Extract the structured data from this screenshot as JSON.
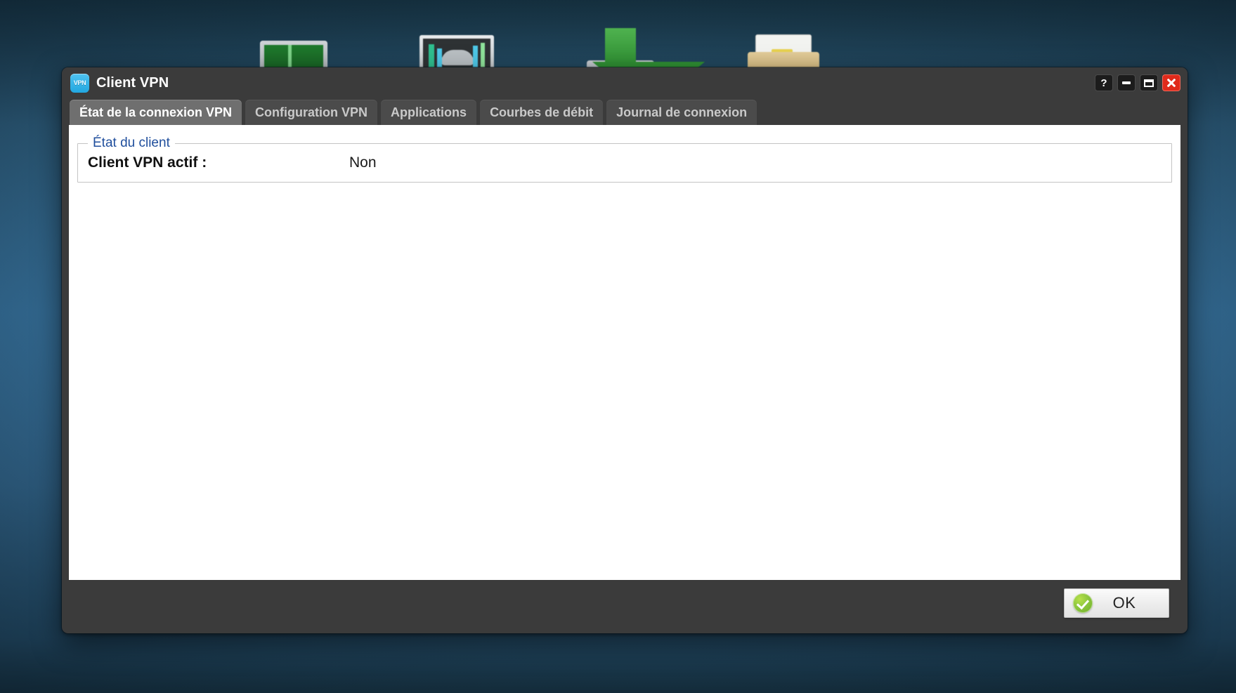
{
  "desktop": {
    "icons": [
      {
        "name": "monitor-green-icon",
        "label": ""
      },
      {
        "name": "tv-testpattern-icon",
        "label": ""
      },
      {
        "name": "download-arrow-icon",
        "label": ""
      },
      {
        "name": "folder-icon",
        "label": ""
      }
    ]
  },
  "window": {
    "title": "Client VPN",
    "app_icon_text": "VPN",
    "controls": {
      "help": "?",
      "minimize": "–",
      "maximize": "□",
      "close": "✕"
    }
  },
  "tabs": [
    {
      "label": "État de la connexion VPN",
      "active": true
    },
    {
      "label": "Configuration VPN",
      "active": false
    },
    {
      "label": "Applications",
      "active": false
    },
    {
      "label": "Courbes de débit",
      "active": false
    },
    {
      "label": "Journal de connexion",
      "active": false
    }
  ],
  "main": {
    "groupbox": {
      "legend": "État du client",
      "rows": [
        {
          "key": "Client VPN actif :",
          "value": "Non"
        }
      ]
    }
  },
  "footer": {
    "ok_label": "OK",
    "ok_icon": "green-check-icon"
  },
  "colors": {
    "titlebar": "#3b3b3b",
    "tab_active": "#6f6f6f",
    "tab_inactive": "#4b4b4b",
    "legend_blue": "#1f4e9c",
    "close_red": "#e02a1b",
    "ok_green": "#8cc63f",
    "app_icon_blue": "#22a7e0",
    "desktop_blue": "#2d5d7e"
  }
}
